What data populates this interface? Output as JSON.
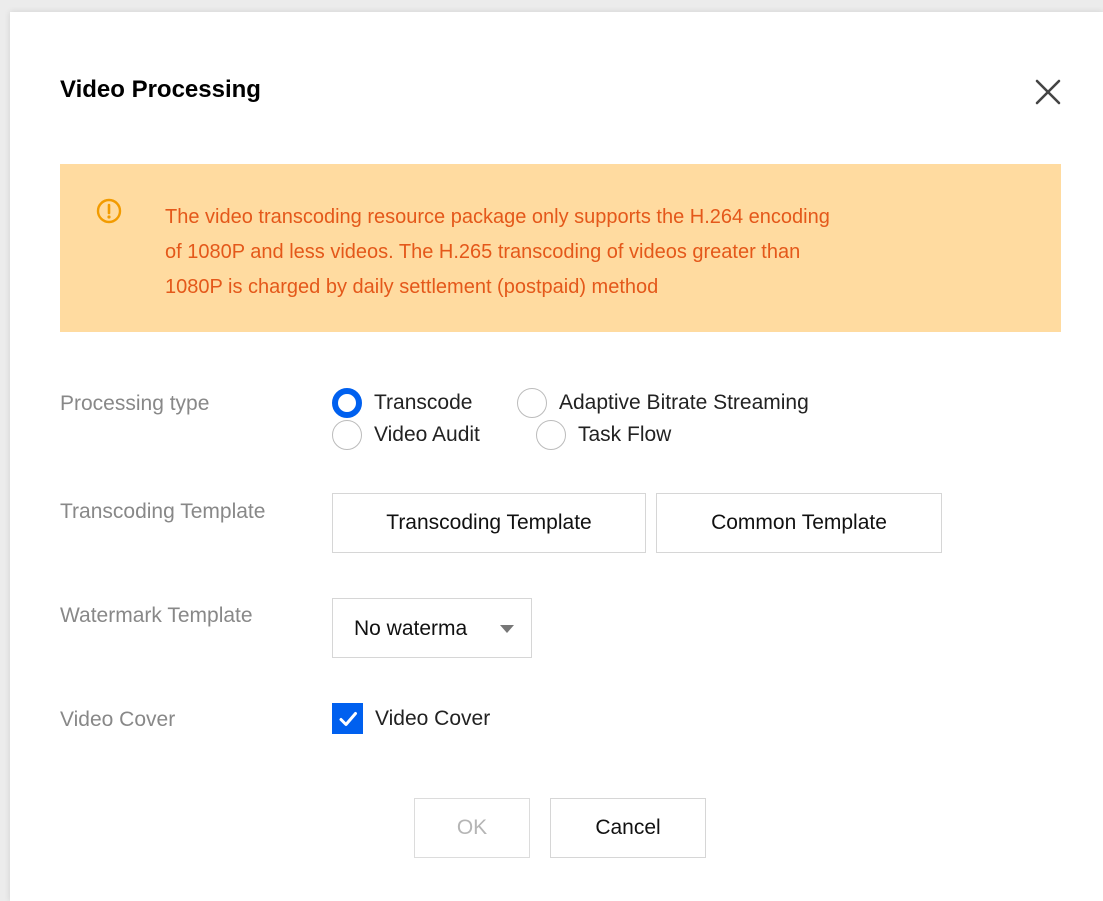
{
  "dialog": {
    "title": "Video Processing",
    "close_icon": "close-icon"
  },
  "alert": {
    "icon": "warning-circle-icon",
    "lines": [
      "The video transcoding resource package only supports the H.264 encoding",
      "of 1080P and less videos. The H.265 transcoding of videos greater than",
      "1080P is charged by daily settlement (postpaid) method"
    ],
    "text_color": "#e4581a",
    "background": "#ffdba0"
  },
  "processing_type": {
    "label": "Processing type",
    "options": [
      {
        "label": "Transcode",
        "checked": true
      },
      {
        "label": "Adaptive Bitrate Streaming",
        "checked": false
      },
      {
        "label": "Video Audit",
        "checked": false
      },
      {
        "label": "Task Flow",
        "checked": false
      }
    ]
  },
  "transcoding_template": {
    "label": "Transcoding Template",
    "buttons": [
      "Transcoding Template",
      "Common Template"
    ]
  },
  "watermark_template": {
    "label": "Watermark Template",
    "selected": "No waterma"
  },
  "video_cover": {
    "label": "Video Cover",
    "checkbox_label": "Video Cover",
    "checked": true
  },
  "footer": {
    "ok_label": "OK",
    "cancel_label": "Cancel"
  },
  "colors": {
    "accent": "#0060ef",
    "label": "#888888"
  }
}
